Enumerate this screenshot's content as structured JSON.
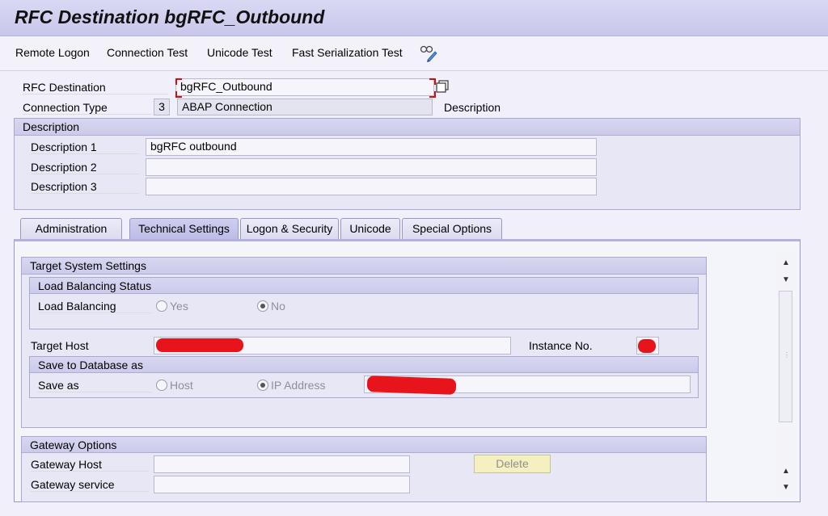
{
  "window": {
    "title": "RFC Destination bgRFC_Outbound"
  },
  "toolbar": {
    "remote_logon": "Remote Logon",
    "connection_test": "Connection Test",
    "unicode_test": "Unicode Test",
    "fast_serialization_test": "Fast Serialization Test"
  },
  "header": {
    "rfc_destination_label": "RFC Destination",
    "rfc_destination_value": "bgRFC_Outbound",
    "connection_type_label": "Connection Type",
    "connection_type_code": "3",
    "connection_type_value": "ABAP Connection",
    "description_link": "Description"
  },
  "description": {
    "title": "Description",
    "rows": [
      {
        "label": "Description 1",
        "value": "bgRFC outbound"
      },
      {
        "label": "Description 2",
        "value": ""
      },
      {
        "label": "Description 3",
        "value": ""
      }
    ]
  },
  "tabs": [
    {
      "label": "Administration"
    },
    {
      "label": "Technical Settings"
    },
    {
      "label": "Logon & Security"
    },
    {
      "label": "Unicode"
    },
    {
      "label": "Special Options"
    }
  ],
  "active_tab": "Technical Settings",
  "target_system": {
    "title": "Target System Settings",
    "load_balancing_status_title": "Load Balancing Status",
    "load_balancing_label": "Load Balancing",
    "yes_label": "Yes",
    "no_label": "No",
    "load_balancing_selected": "No",
    "target_host_label": "Target Host",
    "instance_no_label": "Instance No.",
    "save_to_db_title": "Save to Database as",
    "save_as_label": "Save as",
    "host_label": "Host",
    "ip_address_label": "IP Address",
    "save_as_selected": "IP Address"
  },
  "gateway": {
    "title": "Gateway Options",
    "host_label": "Gateway Host",
    "service_label": "Gateway service",
    "delete_button": "Delete"
  },
  "colors": {
    "accent": "#c8c7ea",
    "redaction": "#e8141c",
    "focus_marker": "#d01010"
  }
}
